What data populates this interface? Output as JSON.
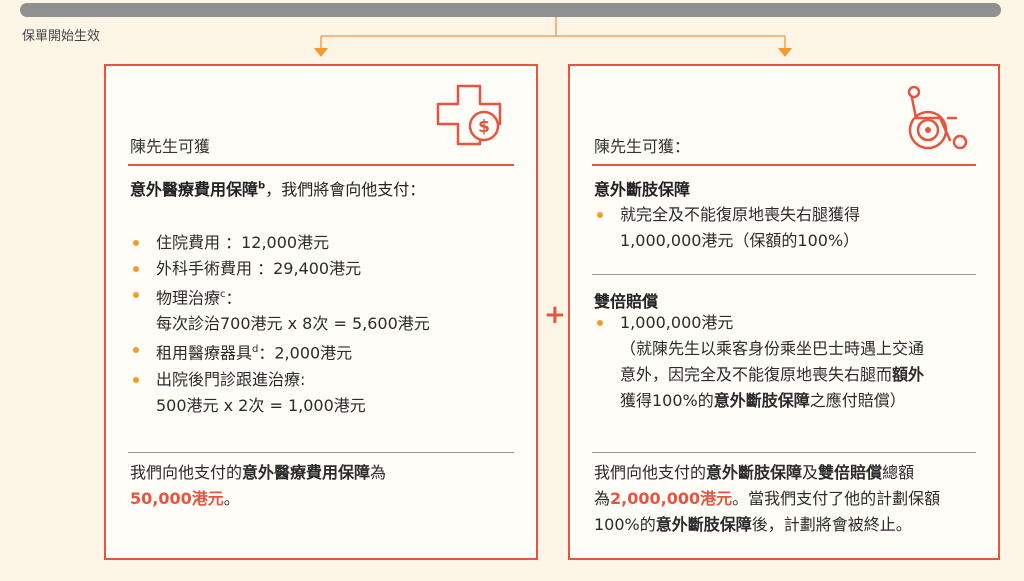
{
  "timeline": {
    "start_label": "保單開始生效"
  },
  "left": {
    "icon": "medical-cross-dollar-icon",
    "title": "陳先生可獲",
    "heading_bold": "意外醫療費用保障",
    "heading_sup": "b",
    "heading_rest": "，我們將會向他支付：",
    "items": [
      {
        "line1": "住院費用 ：12,000港元"
      },
      {
        "line1": "外科手術費用 ：29,400港元"
      },
      {
        "line1": "物理治療",
        "sup": "c",
        "line1_rest": "：",
        "line2": "每次診治700港元 x 8次 = 5,600港元"
      },
      {
        "line1": "租用醫療器具",
        "sup": "d",
        "line1_rest": "：2,000港元"
      },
      {
        "line1": "出院後門診跟進治療:",
        "line2": "500港元 x 2次 = 1,000港元"
      }
    ],
    "summary_pre": "我們向他支付的",
    "summary_bold": "意外醫療費用保障",
    "summary_post": "為",
    "summary_amount": "50,000港元",
    "summary_end": "。"
  },
  "plus": "+",
  "right": {
    "icon": "wheelchair-icon",
    "title": "陳先生可獲：",
    "section1": {
      "heading": "意外斷肢保障",
      "bullet_line1": "就完全及不能復原地喪失右腿獲得",
      "bullet_line2": "1,000,000港元（保額的100%）"
    },
    "section2": {
      "heading": "雙倍賠償",
      "bullet_line1": "1,000,000港元",
      "note_line1": "（就陳先生以乘客身份乘坐巴士時遇上交通",
      "note_line2_pre": "意外，因完全及不能復原地喪失右腿而",
      "note_line2_bold": "額外",
      "note_line3_pre": "獲得100%的",
      "note_line3_bold": "意外斷肢保障",
      "note_line3_post": "之應付賠償）"
    },
    "summary": {
      "l1_pre": "我們向他支付的",
      "l1_bold1": "意外斷肢保障",
      "l1_mid": "及",
      "l1_bold2": "雙倍賠償",
      "l1_post": "總額",
      "l2_pre": "為",
      "l2_amount": "2,000,000港元",
      "l2_post": "。當我們支付了他的計劃保額",
      "l3_pre": "100%的",
      "l3_bold": "意外斷肢保障",
      "l3_post": "後，計劃將會被終止。"
    }
  },
  "colors": {
    "accent": "#e5553f",
    "bullet": "#f39a2a",
    "timeline": "#8f9090",
    "background": "#fdf6e6"
  }
}
